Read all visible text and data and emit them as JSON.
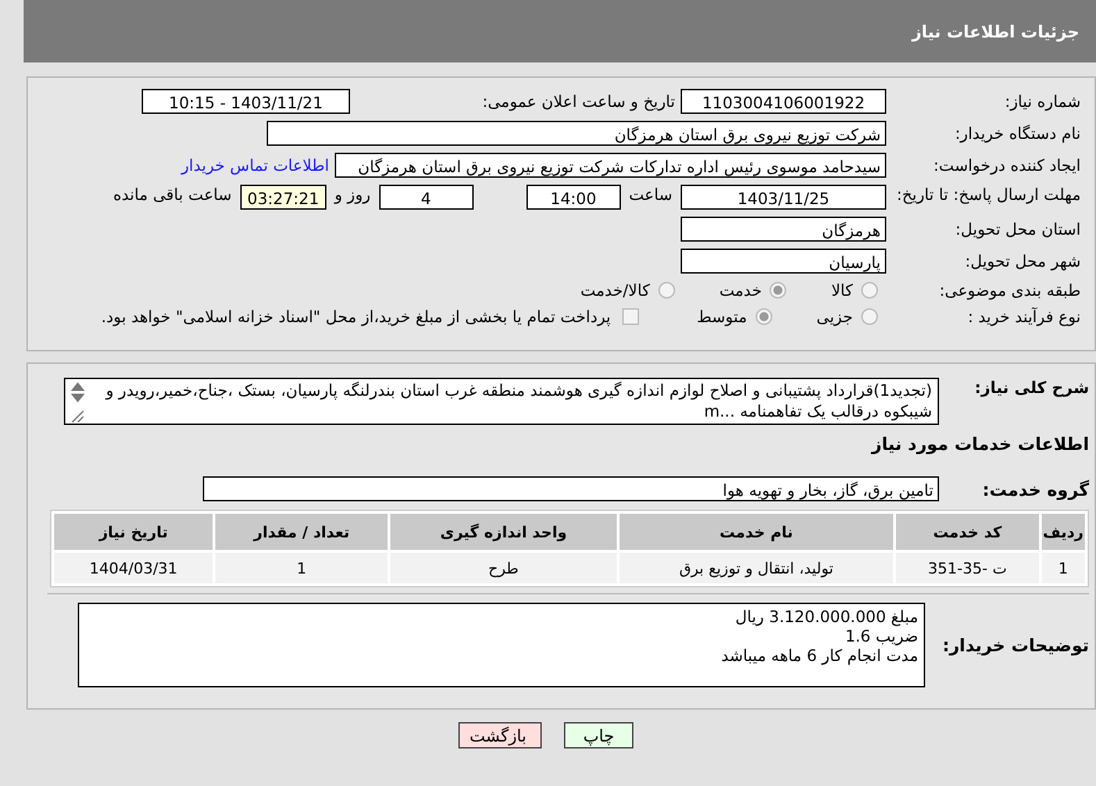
{
  "header": {
    "title": "جزئیات اطلاعات نیاز"
  },
  "need_number": {
    "label": "شماره نیاز:",
    "value": "1103004106001922"
  },
  "announce": {
    "label": "تاریخ و ساعت اعلان عمومی:",
    "value": "1403/11/21 - 10:15"
  },
  "buyer_org": {
    "label": "نام دستگاه خریدار:",
    "value": "شرکت توزیع نیروی برق استان هرمزگان"
  },
  "requester": {
    "label": "ایجاد کننده درخواست:",
    "value": "سیدحامد موسوی رئیس اداره تدارکات شرکت توزیع نیروی برق استان هرمزگان",
    "link": "اطلاعات تماس خریدار"
  },
  "deadline": {
    "label": "مهلت ارسال پاسخ: تا تاریخ:",
    "date": "1403/11/25",
    "time_label": "ساعت",
    "time": "14:00",
    "days": "4",
    "days_label": "روز و",
    "remaining": "03:27:21",
    "remaining_label": "ساعت باقی مانده"
  },
  "province": {
    "label": "استان محل تحویل:",
    "value": "هرمزگان"
  },
  "city": {
    "label": "شهر محل تحویل:",
    "value": "پارسیان"
  },
  "category": {
    "label": "طبقه بندی موضوعی:",
    "options": [
      {
        "label": "کالا",
        "selected": false
      },
      {
        "label": "خدمت",
        "selected": true
      },
      {
        "label": "کالا/خدمت",
        "selected": false
      }
    ]
  },
  "purchase_type": {
    "label": "نوع فرآیند خرید :",
    "options": [
      {
        "label": "جزیی",
        "selected": false
      },
      {
        "label": "متوسط",
        "selected": true
      }
    ],
    "payment": {
      "checked": false,
      "text": "پرداخت تمام یا بخشی از مبلغ خرید،از محل \"اسناد خزانه اسلامی\" خواهد بود."
    }
  },
  "description": {
    "label": "شرح کلی نیاز:",
    "value": "(تجدید1)قرارداد پشتیبانی و اصلاح لوازم اندازه گیری هوشمند منطقه غرب استان بندرلنگه پارسیان، بستک ،جناح،خمیر،رویدر و شیبکوه درقالب یک تفاهمنامه ...m"
  },
  "services_heading": "اطلاعات خدمات مورد نیاز",
  "service_group": {
    "label": "گروه خدمت:",
    "value": "تامین برق، گاز، بخار و تهویه هوا"
  },
  "table": {
    "columns": [
      "ردیف",
      "کد خدمت",
      "نام خدمت",
      "واحد اندازه گیری",
      "تعداد / مقدار",
      "تاریخ نیاز"
    ],
    "rows": [
      [
        "1",
        "ت -35-351",
        "تولید، انتقال و توزیع برق",
        "طرح",
        "1",
        "1404/03/31"
      ]
    ]
  },
  "buyer_notes": {
    "label": "توضیحات خریدار:",
    "lines": [
      "مبلغ 3.120.000.000 ریال",
      "ضریب 1.6",
      "مدت انجام کار 6 ماهه میباشد"
    ]
  },
  "buttons": [
    {
      "label": "چاپ",
      "kind": "print"
    },
    {
      "label": "بازگشت",
      "kind": "back"
    }
  ]
}
